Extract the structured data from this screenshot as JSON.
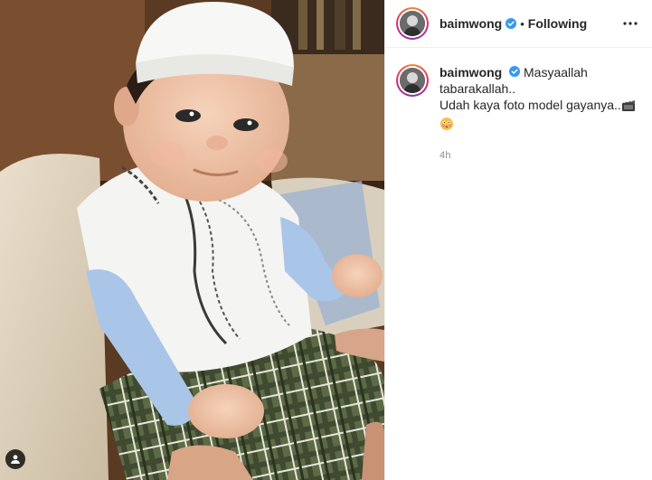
{
  "post": {
    "username": "baimwong",
    "follow_status": "Following",
    "separator": "•",
    "more_label": "More options",
    "caption": {
      "username": "baimwong",
      "text": "Masyaallah\ntabarakallah..\nUdah kaya foto model gayanya..",
      "emojis": [
        "clapper-board-emoji",
        "flushed-face-emoji"
      ]
    },
    "timestamp": "4h"
  },
  "photo": {
    "description_icon": "tagged-user-icon"
  },
  "colors": {
    "verified": "#3897f0",
    "ring_start": "#f58529",
    "ring_mid": "#dd2a7b",
    "ring_end": "#8134af",
    "muted": "#8e8e8e"
  }
}
